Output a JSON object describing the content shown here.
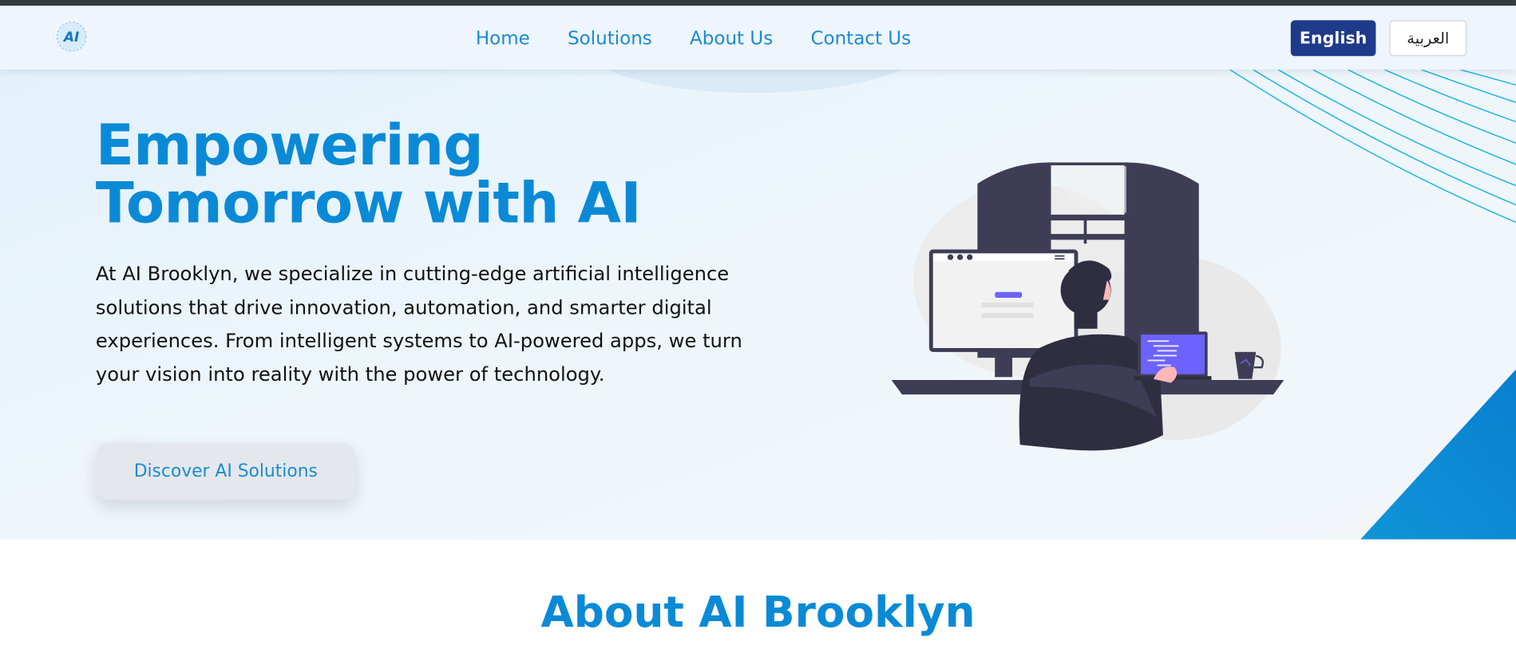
{
  "nav": {
    "logo_text": "AI",
    "links": [
      "Home",
      "Solutions",
      "About Us",
      "Contact Us"
    ],
    "lang_english": "English",
    "lang_arabic": "العربية"
  },
  "hero": {
    "title": "Empowering Tomorrow with AI",
    "description": "At AI Brooklyn, we specialize in cutting-edge artificial intelligence solutions that drive innovation, automation, and smarter digital experiences. From intelligent systems to AI-powered apps, we turn your vision into reality with the power of technology.",
    "cta_label": "Discover AI Solutions"
  },
  "about": {
    "title": "About AI Brooklyn"
  },
  "colors": {
    "brand_blue": "#0a8ad6",
    "nav_link": "#1b8bd0",
    "lang_button": "#1e3a8a",
    "illustration_accent": "#6c63ff",
    "illustration_dark": "#3f3d56"
  },
  "icons": [
    "logo-icon"
  ]
}
